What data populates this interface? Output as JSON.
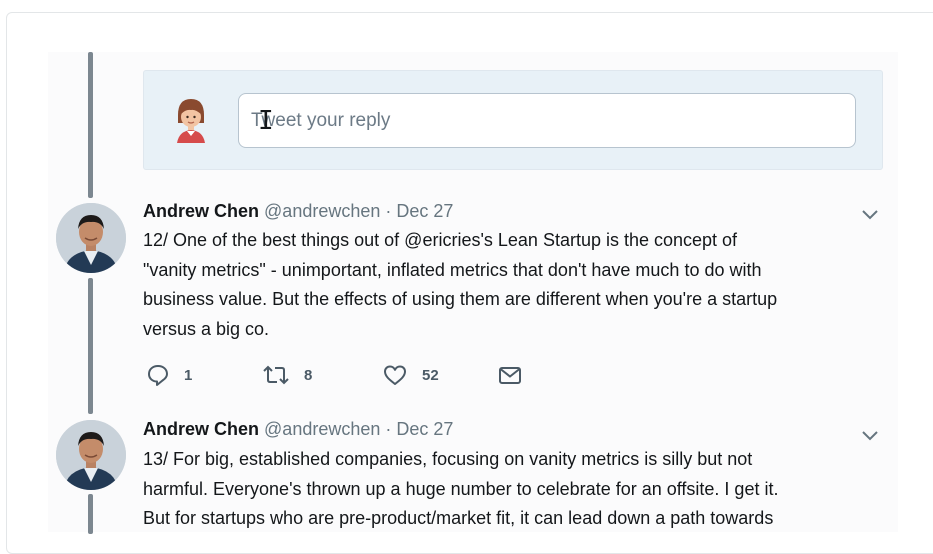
{
  "reply": {
    "placeholder": "Tweet your reply"
  },
  "tweets": [
    {
      "name": "Andrew Chen",
      "handle": "@andrewchen",
      "separator": "·",
      "date": "Dec 27",
      "text": "12/ One of the best things out of @ericries's Lean Startup is the concept of\n\"vanity metrics\" - unimportant, inflated metrics that don't have much to do with\nbusiness value. But the effects of using them are different when you're a startup\nversus a big co.",
      "replies": "1",
      "retweets": "8",
      "likes": "52"
    },
    {
      "name": "Andrew Chen",
      "handle": "@andrewchen",
      "separator": "·",
      "date": "Dec 27",
      "text": "13/ For big, established companies, focusing on vanity metrics is silly but not\nharmful. Everyone's thrown up a huge number to celebrate for an offsite. I get it.\nBut for startups who are pre-product/market fit, it can lead down a path towards"
    }
  ],
  "colors": {
    "thread_line": "#7c8790",
    "reply_box_bg": "#e8f1f7",
    "text": "#14171a",
    "muted": "#66757f"
  }
}
